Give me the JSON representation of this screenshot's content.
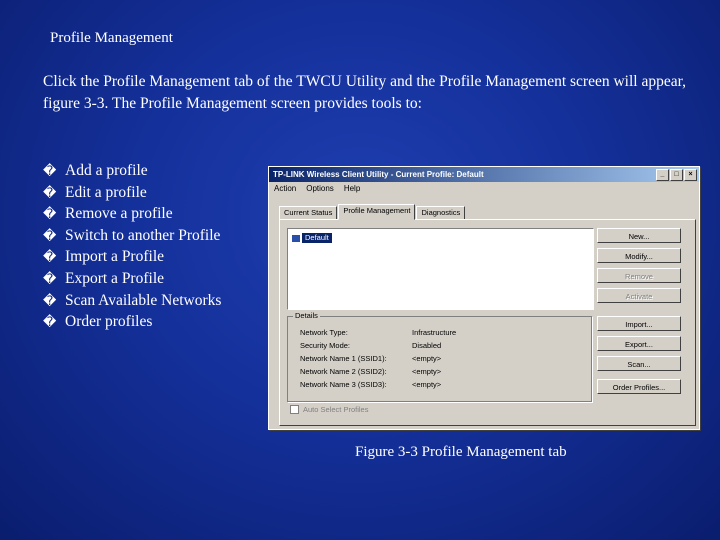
{
  "slide": {
    "title": "Profile Management",
    "intro": "Click the Profile Management tab of the TWCU Utility and the Profile Management screen will appear, figure 3-3. The Profile Management screen provides tools to:",
    "bullet_mark": "�",
    "bullets": [
      "Add a profile",
      "Edit a profile",
      "Remove a profile",
      "Switch to another Profile",
      "Import a Profile",
      "Export a Profile",
      "Scan Available Networks",
      "Order profiles"
    ],
    "caption": "Figure 3-3 Profile Management tab"
  },
  "window": {
    "title": "TP-LINK Wireless Client Utility - Current Profile: Default",
    "buttons": {
      "minimize": "_",
      "maximize": "□",
      "close": "×"
    },
    "menu": [
      "Action",
      "Options",
      "Help"
    ],
    "tabs": [
      "Current Status",
      "Profile Management",
      "Diagnostics"
    ],
    "active_tab": "Profile Management",
    "profile_list": [
      "Default"
    ],
    "actions": [
      "New...",
      "Modify...",
      "Remove",
      "Activate",
      "Import...",
      "Export...",
      "Scan...",
      "Order Profiles..."
    ],
    "disabled_actions": [
      "Remove",
      "Activate"
    ],
    "details": {
      "legend": "Details",
      "rows": [
        {
          "label": "Network Type:",
          "value": "Infrastructure"
        },
        {
          "label": "Security Mode:",
          "value": "Disabled"
        },
        {
          "label": "Network Name 1 (SSID1):",
          "value": "<empty>"
        },
        {
          "label": "Network Name 2 (SSID2):",
          "value": "<empty>"
        },
        {
          "label": "Network Name 3 (SSID3):",
          "value": "<empty>"
        }
      ]
    },
    "auto_select": {
      "label": "Auto Select Profiles",
      "checked": false
    }
  }
}
